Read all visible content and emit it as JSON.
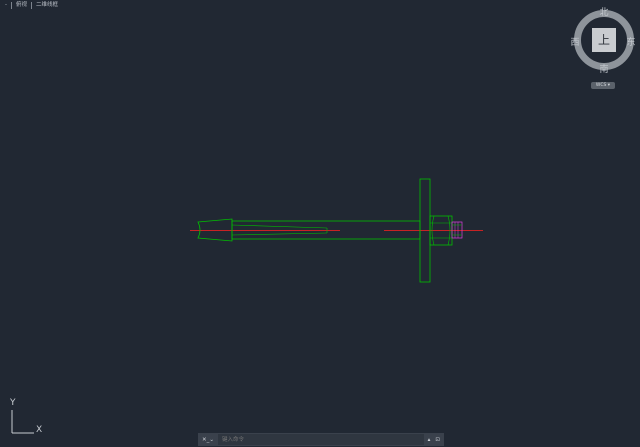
{
  "viewport": {
    "menu": "-",
    "view": "俯视",
    "style": "二维线框"
  },
  "viewcube": {
    "face": "上",
    "north": "北",
    "south": "南",
    "east": "东",
    "west": "西",
    "wcs": "WCS ▾"
  },
  "ucs": {
    "x": "X",
    "y": "Y"
  },
  "command": {
    "left_icon": "✕_⌄",
    "placeholder": "键入命令",
    "right_icon_1": "▴",
    "right_icon_2": "⊡"
  },
  "colors": {
    "background": "#212833",
    "geometry": "#00c800",
    "centerline": "#ff0000",
    "thread": "#ff00ff"
  }
}
